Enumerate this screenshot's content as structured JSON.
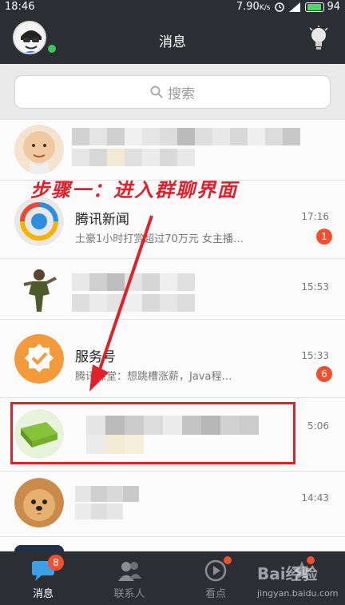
{
  "status_bar": {
    "time": "18:46",
    "network_speed": "7.90",
    "network_unit": "K/s",
    "battery": "94"
  },
  "header": {
    "title": "消息"
  },
  "search": {
    "placeholder": "搜索"
  },
  "conversations": [
    {
      "name": "",
      "preview": "",
      "time": "",
      "badge": ""
    },
    {
      "name": "腾讯新闻",
      "preview": "土豪1小时打赏超过70万元 女主播…",
      "time": "17:16",
      "badge": "1"
    },
    {
      "name": "",
      "preview": "",
      "time": "15:53",
      "badge": ""
    },
    {
      "name": "服务号",
      "preview": "腾讯课堂：想跳槽涨薪，Java程…",
      "time": "15:33",
      "badge": "6"
    },
    {
      "name": "",
      "preview": "",
      "time": "5:06",
      "badge": ""
    },
    {
      "name": "",
      "preview": "",
      "time": "14:43",
      "badge": ""
    }
  ],
  "annotation": {
    "step_text": "步骤一：进入群聊界面"
  },
  "tabs": [
    {
      "label": "消息",
      "badge": "8",
      "icon": "message-icon"
    },
    {
      "label": "联系人",
      "badge": "",
      "icon": "contacts-icon"
    },
    {
      "label": "看点",
      "badge": "",
      "icon": "play-icon"
    },
    {
      "label": "",
      "badge": "",
      "icon": "star-icon"
    }
  ],
  "watermark": {
    "brand": "Bai经验",
    "url": "jingyan.baidu.com"
  },
  "colors": {
    "bar": "#2b2e33",
    "badge": "#f0502f",
    "annotation_red": "#e0202a"
  }
}
